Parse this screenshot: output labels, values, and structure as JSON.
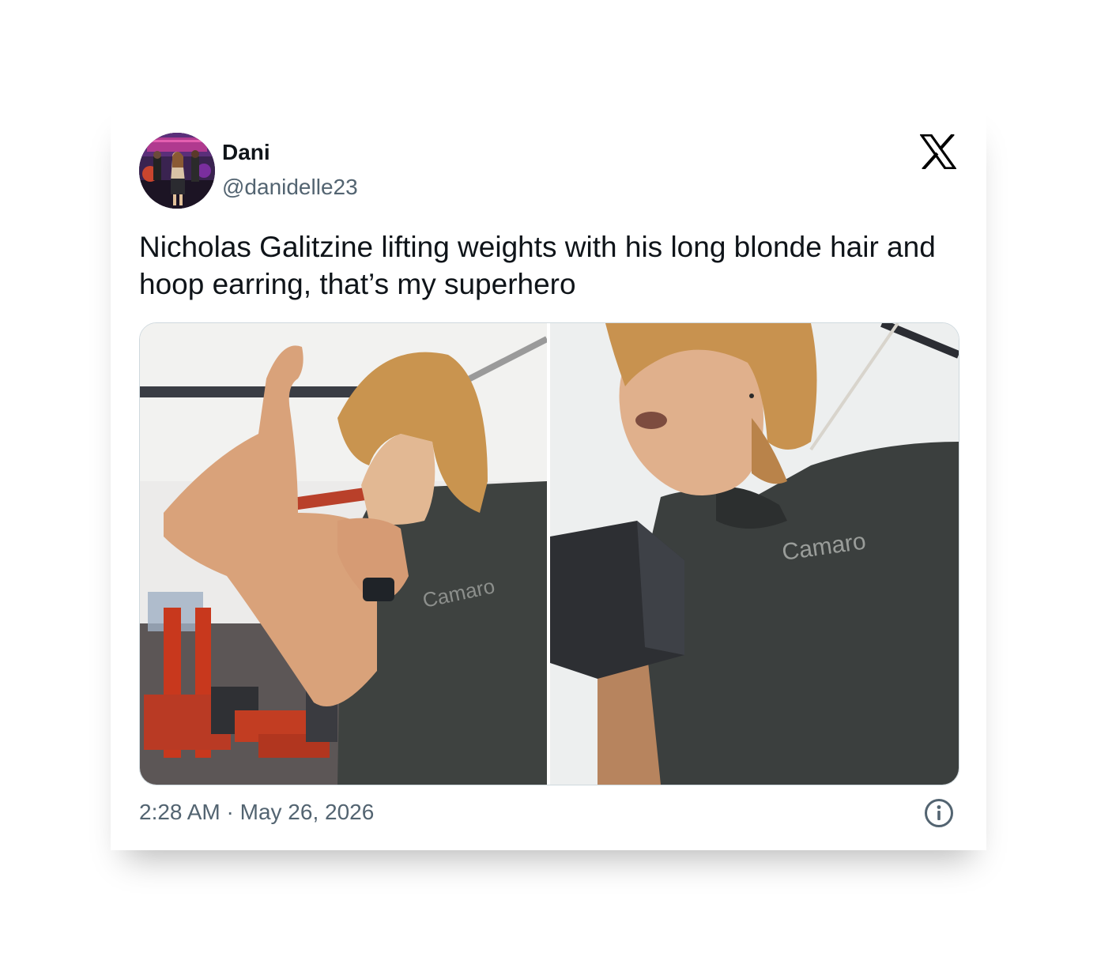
{
  "tweet": {
    "author": {
      "display_name": "Dani",
      "handle": "@danidelle23",
      "avatar_icon": "avatar-photo"
    },
    "text": "Nicholas Galitzine lifting weights with his long blonde hair and hoop earring, that’s my superhero",
    "media": [
      {
        "icon": "photo-flexing-bicep",
        "shirt_text": "Camaro"
      },
      {
        "icon": "photo-dumbbell-curl",
        "shirt_text": "Camaro"
      }
    ],
    "time": "2:28 AM",
    "separator": " · ",
    "date": "May 26, 2026"
  },
  "brand": {
    "logo_icon": "x-logo",
    "info_icon": "info-icon"
  },
  "colors": {
    "text_primary": "#0f1419",
    "text_secondary": "#536471",
    "border": "#cfd9de",
    "background": "#ffffff"
  }
}
